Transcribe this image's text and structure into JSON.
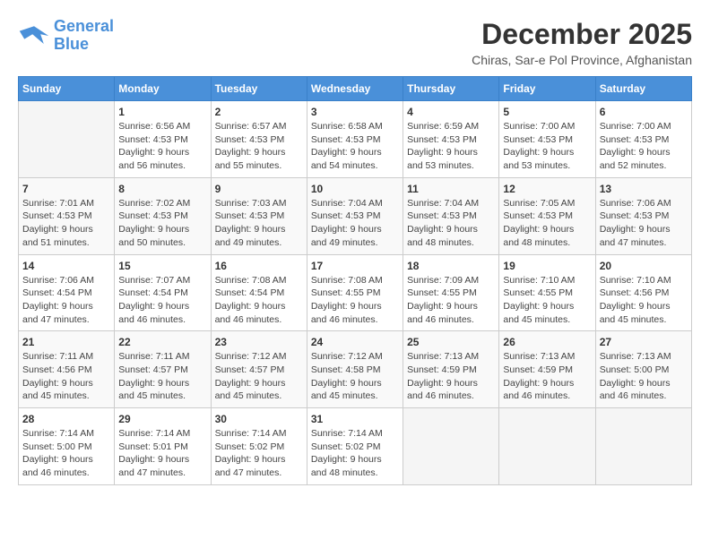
{
  "header": {
    "logo_line1": "General",
    "logo_line2": "Blue",
    "month_title": "December 2025",
    "location": "Chiras, Sar-e Pol Province, Afghanistan"
  },
  "weekdays": [
    "Sunday",
    "Monday",
    "Tuesday",
    "Wednesday",
    "Thursday",
    "Friday",
    "Saturday"
  ],
  "weeks": [
    [
      {
        "day": "",
        "info": ""
      },
      {
        "day": "1",
        "info": "Sunrise: 6:56 AM\nSunset: 4:53 PM\nDaylight: 9 hours\nand 56 minutes."
      },
      {
        "day": "2",
        "info": "Sunrise: 6:57 AM\nSunset: 4:53 PM\nDaylight: 9 hours\nand 55 minutes."
      },
      {
        "day": "3",
        "info": "Sunrise: 6:58 AM\nSunset: 4:53 PM\nDaylight: 9 hours\nand 54 minutes."
      },
      {
        "day": "4",
        "info": "Sunrise: 6:59 AM\nSunset: 4:53 PM\nDaylight: 9 hours\nand 53 minutes."
      },
      {
        "day": "5",
        "info": "Sunrise: 7:00 AM\nSunset: 4:53 PM\nDaylight: 9 hours\nand 53 minutes."
      },
      {
        "day": "6",
        "info": "Sunrise: 7:00 AM\nSunset: 4:53 PM\nDaylight: 9 hours\nand 52 minutes."
      }
    ],
    [
      {
        "day": "7",
        "info": "Sunrise: 7:01 AM\nSunset: 4:53 PM\nDaylight: 9 hours\nand 51 minutes."
      },
      {
        "day": "8",
        "info": "Sunrise: 7:02 AM\nSunset: 4:53 PM\nDaylight: 9 hours\nand 50 minutes."
      },
      {
        "day": "9",
        "info": "Sunrise: 7:03 AM\nSunset: 4:53 PM\nDaylight: 9 hours\nand 49 minutes."
      },
      {
        "day": "10",
        "info": "Sunrise: 7:04 AM\nSunset: 4:53 PM\nDaylight: 9 hours\nand 49 minutes."
      },
      {
        "day": "11",
        "info": "Sunrise: 7:04 AM\nSunset: 4:53 PM\nDaylight: 9 hours\nand 48 minutes."
      },
      {
        "day": "12",
        "info": "Sunrise: 7:05 AM\nSunset: 4:53 PM\nDaylight: 9 hours\nand 48 minutes."
      },
      {
        "day": "13",
        "info": "Sunrise: 7:06 AM\nSunset: 4:53 PM\nDaylight: 9 hours\nand 47 minutes."
      }
    ],
    [
      {
        "day": "14",
        "info": "Sunrise: 7:06 AM\nSunset: 4:54 PM\nDaylight: 9 hours\nand 47 minutes."
      },
      {
        "day": "15",
        "info": "Sunrise: 7:07 AM\nSunset: 4:54 PM\nDaylight: 9 hours\nand 46 minutes."
      },
      {
        "day": "16",
        "info": "Sunrise: 7:08 AM\nSunset: 4:54 PM\nDaylight: 9 hours\nand 46 minutes."
      },
      {
        "day": "17",
        "info": "Sunrise: 7:08 AM\nSunset: 4:55 PM\nDaylight: 9 hours\nand 46 minutes."
      },
      {
        "day": "18",
        "info": "Sunrise: 7:09 AM\nSunset: 4:55 PM\nDaylight: 9 hours\nand 46 minutes."
      },
      {
        "day": "19",
        "info": "Sunrise: 7:10 AM\nSunset: 4:55 PM\nDaylight: 9 hours\nand 45 minutes."
      },
      {
        "day": "20",
        "info": "Sunrise: 7:10 AM\nSunset: 4:56 PM\nDaylight: 9 hours\nand 45 minutes."
      }
    ],
    [
      {
        "day": "21",
        "info": "Sunrise: 7:11 AM\nSunset: 4:56 PM\nDaylight: 9 hours\nand 45 minutes."
      },
      {
        "day": "22",
        "info": "Sunrise: 7:11 AM\nSunset: 4:57 PM\nDaylight: 9 hours\nand 45 minutes."
      },
      {
        "day": "23",
        "info": "Sunrise: 7:12 AM\nSunset: 4:57 PM\nDaylight: 9 hours\nand 45 minutes."
      },
      {
        "day": "24",
        "info": "Sunrise: 7:12 AM\nSunset: 4:58 PM\nDaylight: 9 hours\nand 45 minutes."
      },
      {
        "day": "25",
        "info": "Sunrise: 7:13 AM\nSunset: 4:59 PM\nDaylight: 9 hours\nand 46 minutes."
      },
      {
        "day": "26",
        "info": "Sunrise: 7:13 AM\nSunset: 4:59 PM\nDaylight: 9 hours\nand 46 minutes."
      },
      {
        "day": "27",
        "info": "Sunrise: 7:13 AM\nSunset: 5:00 PM\nDaylight: 9 hours\nand 46 minutes."
      }
    ],
    [
      {
        "day": "28",
        "info": "Sunrise: 7:14 AM\nSunset: 5:00 PM\nDaylight: 9 hours\nand 46 minutes."
      },
      {
        "day": "29",
        "info": "Sunrise: 7:14 AM\nSunset: 5:01 PM\nDaylight: 9 hours\nand 47 minutes."
      },
      {
        "day": "30",
        "info": "Sunrise: 7:14 AM\nSunset: 5:02 PM\nDaylight: 9 hours\nand 47 minutes."
      },
      {
        "day": "31",
        "info": "Sunrise: 7:14 AM\nSunset: 5:02 PM\nDaylight: 9 hours\nand 48 minutes."
      },
      {
        "day": "",
        "info": ""
      },
      {
        "day": "",
        "info": ""
      },
      {
        "day": "",
        "info": ""
      }
    ]
  ]
}
